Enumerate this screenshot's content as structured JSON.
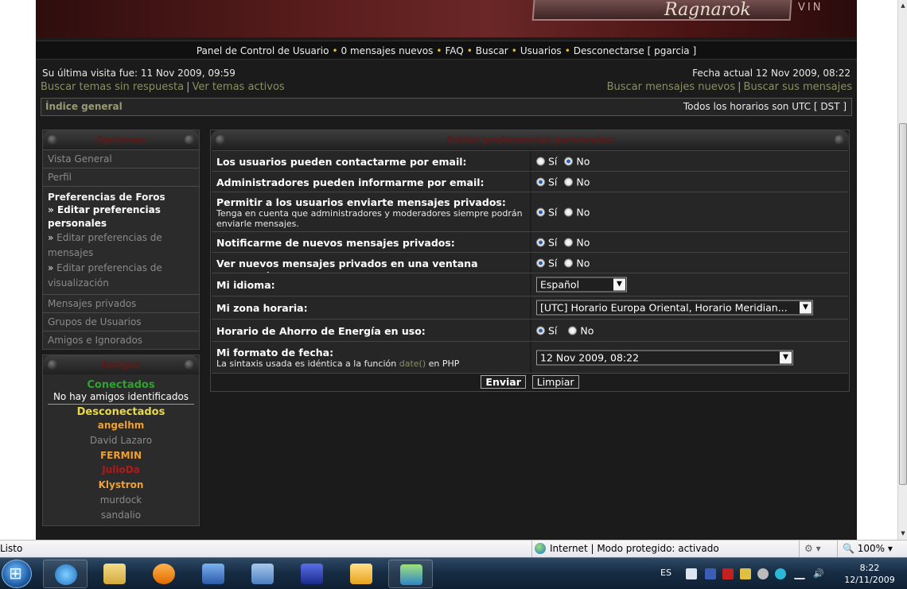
{
  "banner": {
    "logo_text": "Ragnarok",
    "side_text": "VIN"
  },
  "topnav": {
    "items": [
      "Panel de Control de Usuario",
      "0 mensajes nuevos",
      "FAQ",
      "Buscar",
      "Usuarios"
    ],
    "logout": "Desconectarse [ pgarcia ]"
  },
  "visit": {
    "last_visit": "Su última visita fue: 11 Nov 2009, 09:59",
    "current_date": "Fecha actual 12 Nov 2009, 08:22"
  },
  "links": {
    "unanswered": "Buscar temas sin respuesta",
    "active": "Ver temas activos",
    "new_posts": "Buscar mensajes nuevos",
    "your_posts": "Buscar sus mensajes",
    "separator": "|"
  },
  "breadcrumb": {
    "home": "Índice general",
    "timezone": "Todos los horarios son UTC [ DST ]"
  },
  "options_panel": {
    "title": "Opciones",
    "overview": "Vista General",
    "profile": "Perfil",
    "board_prefs": "Preferencias de Foros",
    "sub_marker": "»",
    "sub_items": [
      "Editar preferencias personales",
      "Editar preferencias de mensajes",
      "Editar preferencias de visualización"
    ],
    "private_messages": "Mensajes privados",
    "user_groups": "Grupos de Usuarios",
    "friends_foes": "Amigos e Ignorados"
  },
  "friends_panel": {
    "title": "Amigos",
    "online_heading": "Conectados",
    "online_empty": "No hay amigos identificados",
    "offline_heading": "Desconectados",
    "friends": [
      {
        "name": "angelhm",
        "color": "#f0a030",
        "bold": true
      },
      {
        "name": "David Lazaro",
        "color": "#8a8a8a",
        "bold": false
      },
      {
        "name": "FERMIN",
        "color": "#f0a030",
        "bold": true
      },
      {
        "name": "JulioDa",
        "color": "#b01a1a",
        "bold": true
      },
      {
        "name": "Klystron",
        "color": "#f0a030",
        "bold": true
      },
      {
        "name": "murdock",
        "color": "#8a8a8a",
        "bold": false
      },
      {
        "name": "sandalio",
        "color": "#8a8a8a",
        "bold": false
      }
    ]
  },
  "prefs": {
    "title": "Editar preferencias personales",
    "yes": "Sí",
    "no": "No",
    "rows": [
      {
        "label": "Los usuarios pueden contactarme por email:",
        "value": "no"
      },
      {
        "label": "Administradores pueden informarme por email:",
        "value": "yes"
      },
      {
        "label": "Permitir a los usuarios enviarte mensajes privados:",
        "note": "Tenga en cuenta que administradores y moderadores siempre podrán enviarle mensajes.",
        "value": "yes"
      },
      {
        "label": "Notificarme de nuevos mensajes privados:",
        "value": "yes"
      },
      {
        "label": "Ver nuevos mensajes privados en una ventana emergente:",
        "value": "yes"
      }
    ],
    "language": {
      "label": "Mi idioma:",
      "selected": "Español"
    },
    "timezone": {
      "label": "Mi zona horaria:",
      "selected": "[UTC] Horario Europa Oriental, Horario Meridian..."
    },
    "dst": {
      "label": "Horario de Ahorro de Energía en uso:",
      "value": "yes"
    },
    "dateformat": {
      "label": "Mi formato de fecha:",
      "note_before": "La sintaxis usada es idéntica a la función",
      "note_fn": "date()",
      "note_after": "en PHP",
      "selected": "12 Nov 2009, 08:22"
    },
    "submit": "Enviar",
    "reset": "Limpiar"
  },
  "statusbar": {
    "status": "Listo",
    "zone": "Internet | Modo protegido: activado",
    "zoom": "100%"
  },
  "taskbar": {
    "language": "ES",
    "time": "8:22",
    "date": "12/11/2009",
    "apps": [
      "internet-explorer",
      "explorer-folder",
      "media-player",
      "network-globe",
      "network-computers",
      "shield-app",
      "outlook-express",
      "msn-messenger"
    ]
  },
  "colors": {
    "link": "#8c8f62",
    "accent_dot": "#e5c130",
    "panel_title": "#5c1a1a",
    "online": "#2fa32f",
    "offline": "#e8d84b"
  }
}
